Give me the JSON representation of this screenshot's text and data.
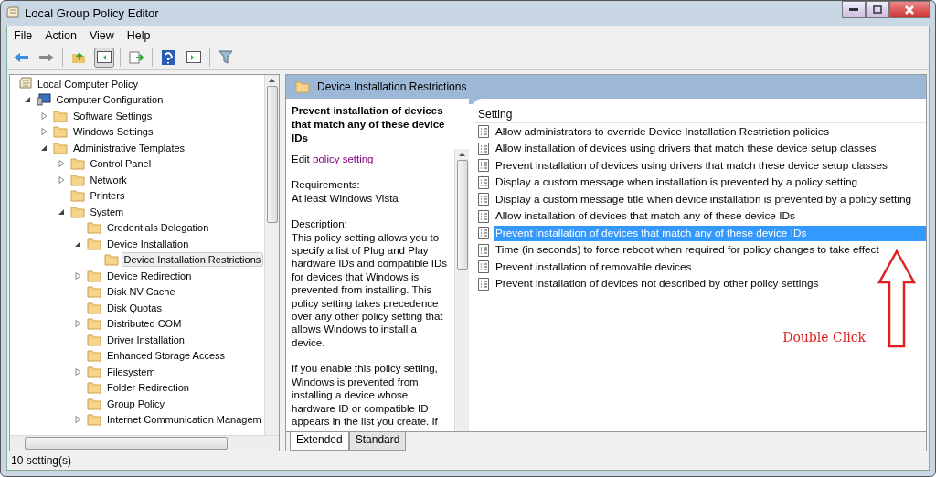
{
  "window": {
    "title": "Local Group Policy Editor"
  },
  "menu": [
    "File",
    "Action",
    "View",
    "Help"
  ],
  "tree": [
    {
      "label": "Local Computer Policy",
      "kind": "root",
      "selected": false,
      "children": [
        {
          "label": "Computer Configuration",
          "kind": "computer",
          "expanded": true,
          "selected": false,
          "children": [
            {
              "label": "Software Settings",
              "expanded": false,
              "selected": false
            },
            {
              "label": "Windows Settings",
              "expanded": false,
              "selected": false
            },
            {
              "label": "Administrative Templates",
              "expanded": true,
              "selected": false,
              "children": [
                {
                  "label": "Control Panel",
                  "expanded": false,
                  "selected": false
                },
                {
                  "label": "Network",
                  "expanded": false,
                  "selected": false
                },
                {
                  "label": "Printers",
                  "selected": false
                },
                {
                  "label": "System",
                  "expanded": true,
                  "selected": false,
                  "children": [
                    {
                      "label": "Credentials Delegation",
                      "selected": false
                    },
                    {
                      "label": "Device Installation",
                      "expanded": true,
                      "selected": false,
                      "children": [
                        {
                          "label": "Device Installation Restrictions",
                          "selected": true
                        }
                      ]
                    },
                    {
                      "label": "Device Redirection",
                      "expanded": false,
                      "selected": false
                    },
                    {
                      "label": "Disk NV Cache",
                      "selected": false
                    },
                    {
                      "label": "Disk Quotas",
                      "selected": false
                    },
                    {
                      "label": "Distributed COM",
                      "expanded": false,
                      "selected": false
                    },
                    {
                      "label": "Driver Installation",
                      "selected": false
                    },
                    {
                      "label": "Enhanced Storage Access",
                      "selected": false
                    },
                    {
                      "label": "Filesystem",
                      "expanded": false,
                      "selected": false
                    },
                    {
                      "label": "Folder Redirection",
                      "selected": false
                    },
                    {
                      "label": "Group Policy",
                      "selected": false
                    },
                    {
                      "label": "Internet Communication Managem",
                      "expanded": false,
                      "selected": false
                    }
                  ]
                }
              ]
            }
          ]
        }
      ]
    }
  ],
  "header": {
    "title": "Device Installation Restrictions"
  },
  "details": {
    "title": "Prevent installation of devices that match any of these device IDs",
    "edit_prefix": "Edit",
    "edit_link": "policy setting",
    "requirements_label": "Requirements:",
    "requirements": "At least Windows Vista",
    "description_label": "Description:",
    "paragraphs": [
      "This policy setting allows you to specify a list of Plug and Play hardware IDs and compatible IDs for devices that Windows is prevented from installing. This policy setting takes precedence over any other policy setting that allows Windows to install a device.",
      "If you enable this policy setting, Windows is prevented from installing a device whose hardware ID or compatible ID appears in the list you create. If"
    ]
  },
  "table": {
    "columns": [
      "Setting"
    ],
    "rows": [
      {
        "setting": "Allow administrators to override Device Installation Restriction policies",
        "selected": false
      },
      {
        "setting": "Allow installation of devices using drivers that match these device setup classes",
        "selected": false
      },
      {
        "setting": "Prevent installation of devices using drivers that match these device setup classes",
        "selected": false
      },
      {
        "setting": "Display a custom message when installation is prevented by a policy setting",
        "selected": false
      },
      {
        "setting": "Display a custom message title when device installation is prevented by a policy setting",
        "selected": false
      },
      {
        "setting": "Allow installation of devices that match any of these device IDs",
        "selected": false
      },
      {
        "setting": "Prevent installation of devices that match any of these device IDs",
        "selected": true
      },
      {
        "setting": "Time (in seconds) to force reboot when required for policy changes to take effect",
        "selected": false
      },
      {
        "setting": "Prevent installation of removable devices",
        "selected": false
      },
      {
        "setting": "Prevent installation of devices not described by other policy settings",
        "selected": false
      }
    ]
  },
  "annotation": {
    "text": "Double Click"
  },
  "tabs": [
    {
      "label": "Extended",
      "selected": true
    },
    {
      "label": "Standard",
      "selected": false
    }
  ],
  "status_bar": "10 setting(s)"
}
